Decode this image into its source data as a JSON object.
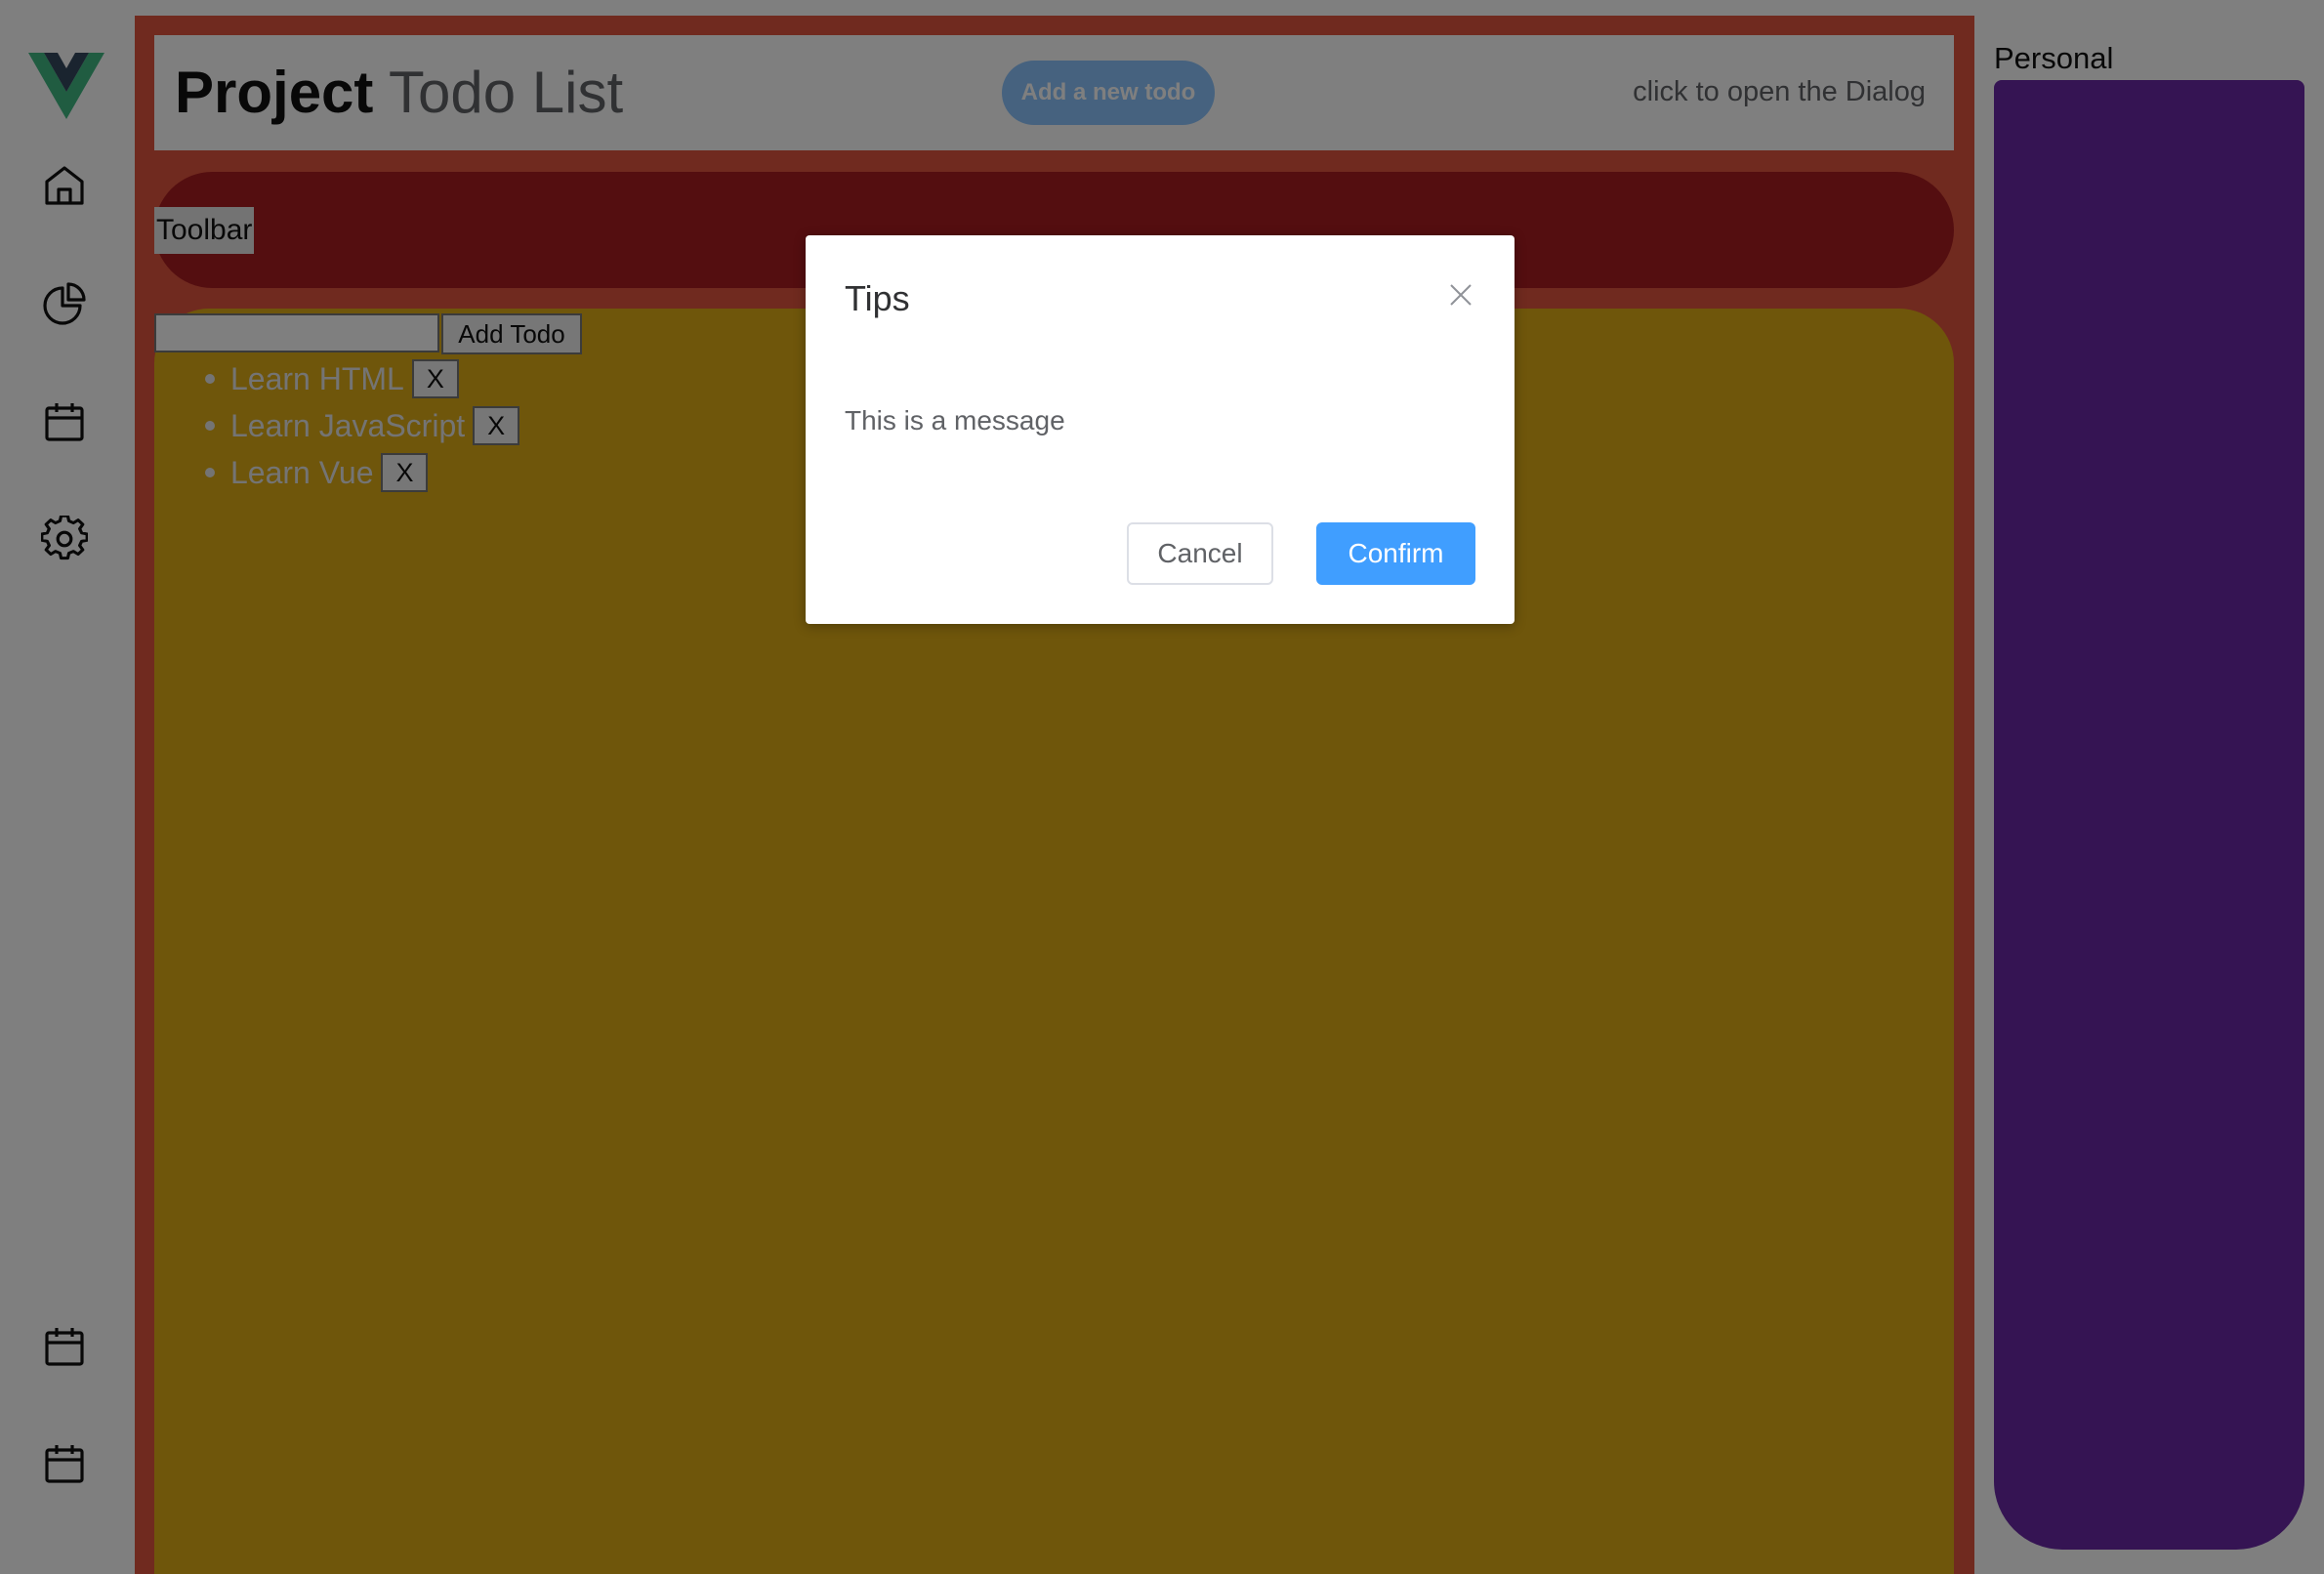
{
  "header": {
    "title_strong": "Project",
    "title_light": "Todo List",
    "add_button": "Add a new todo",
    "open_hint": "click to open the Dialog"
  },
  "toolbar": {
    "label": "Toolbar"
  },
  "todo": {
    "add_button": "Add Todo",
    "input_value": "",
    "items": [
      {
        "text": "Learn HTML",
        "remove": "X"
      },
      {
        "text": "Learn JavaScript",
        "remove": "X"
      },
      {
        "text": "Learn Vue",
        "remove": "X"
      }
    ]
  },
  "right_panel": {
    "label": "Personal"
  },
  "sidebar": {
    "icons": [
      "vue-logo-icon",
      "home-icon",
      "pie-chart-icon",
      "calendar-icon",
      "gear-icon",
      "calendar-icon",
      "calendar-icon"
    ]
  },
  "dialog": {
    "title": "Tips",
    "message": "This is a message",
    "cancel": "Cancel",
    "confirm": "Confirm"
  },
  "colors": {
    "main_bg": "#e1553f",
    "toolbar_bg": "#a81d21",
    "content_bg": "#dfad16",
    "panel_bg": "#6b28a6",
    "add_button_bg": "#8cc5ff",
    "confirm_bg": "#409eff"
  }
}
